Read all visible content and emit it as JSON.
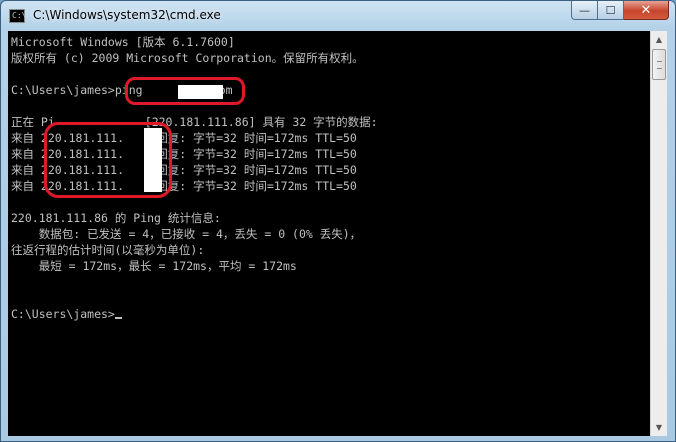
{
  "window": {
    "title": "C:\\Windows\\system32\\cmd.exe",
    "icon": "cmd-console-icon",
    "icon_glyph": "C:\\",
    "controls": {
      "minimize": "—",
      "maximize": "☐",
      "close": "✕"
    }
  },
  "console": {
    "lines": [
      "Microsoft Windows [版本 6.1.7600]",
      "版权所有 (c) 2009 Microsoft Corporation。保留所有权利。",
      "",
      "C:\\Users\\james>ping         .com",
      "",
      "正在 Ping           [220.181.111.86] 具有 32 字节的数据:",
      "来自 220.181.111.   的回复: 字节=32 时间=172ms TTL=50",
      "来自 220.181.111.   的回复: 字节=32 时间=172ms TTL=50",
      "来自 220.181.111.   的回复: 字节=32 时间=172ms TTL=50",
      "来自 220.181.111.   的回复: 字节=32 时间=172ms TTL=50",
      "",
      "220.181.111.86 的 Ping 统计信息:",
      "    数据包: 已发送 = 4，已接收 = 4，丢失 = 0 (0% 丢失)，",
      "往返行程的估计时间(以毫秒为单位):",
      "    最短 = 172ms，最长 = 172ms，平均 = 172ms",
      "",
      "",
      "C:\\Users\\james>"
    ],
    "text_color": "#c0c0c0",
    "background": "#000000"
  },
  "annotations": {
    "highlight_color": "#e0192a"
  },
  "scrollbar": {
    "up_arrow": "▲",
    "down_arrow": "▼"
  }
}
